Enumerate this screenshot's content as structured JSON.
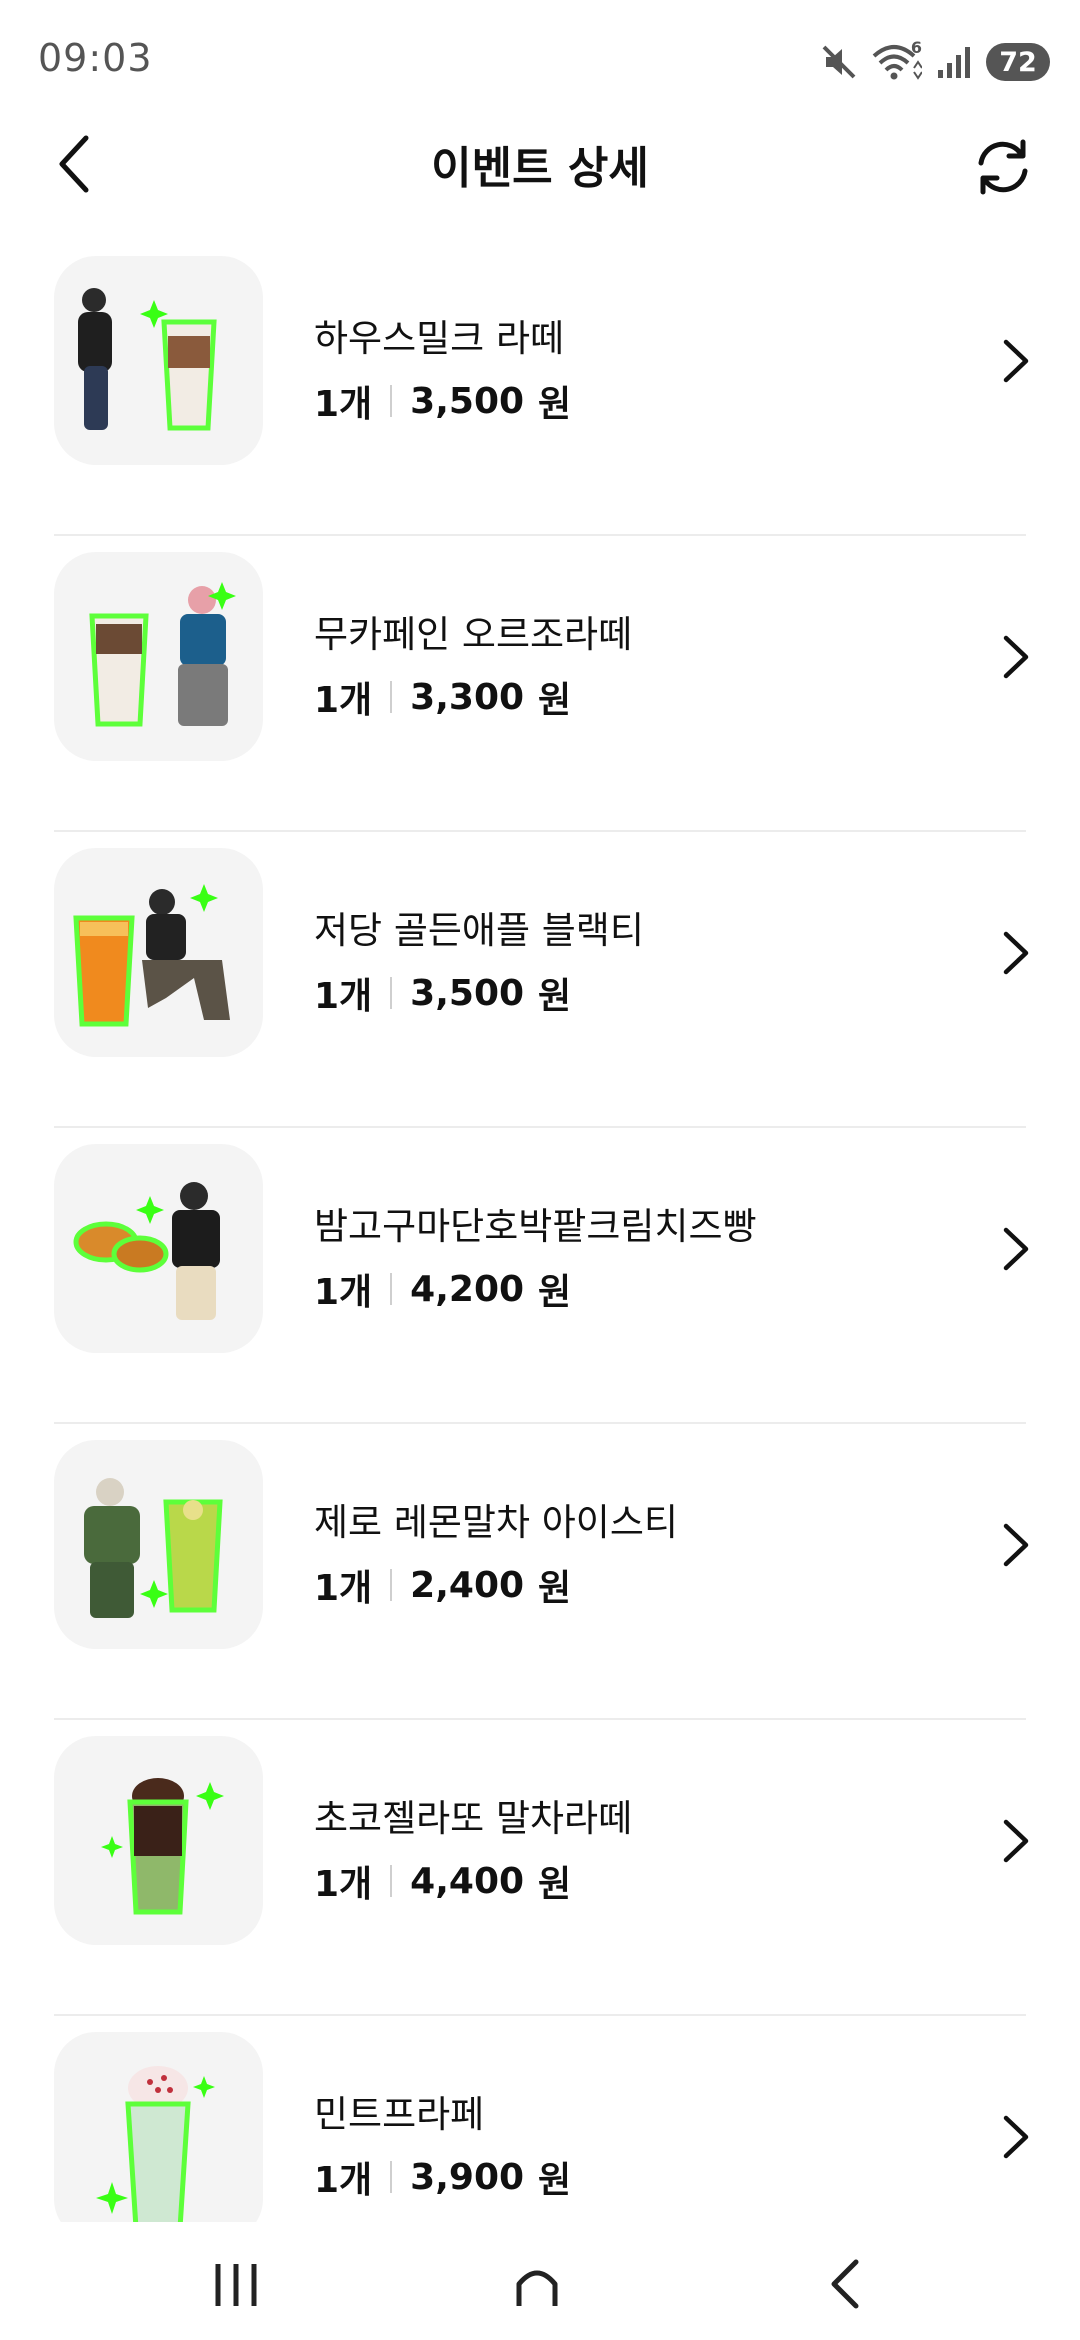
{
  "status_bar": {
    "time": "09:03",
    "battery": "72",
    "wifi_badge": "6",
    "icons": [
      "mute-icon",
      "wifi-icon",
      "signal-icon",
      "battery-icon"
    ]
  },
  "header": {
    "title": "이벤트 상세",
    "back_icon": "chevron-left-icon",
    "refresh_icon": "refresh-icon"
  },
  "items": [
    {
      "name": "하우스밀크 라떼",
      "qty": "1개",
      "price": "3,500",
      "unit": "원"
    },
    {
      "name": "무카페인 오르조라떼",
      "qty": "1개",
      "price": "3,300",
      "unit": "원"
    },
    {
      "name": "저당 골든애플 블랙티",
      "qty": "1개",
      "price": "3,500",
      "unit": "원"
    },
    {
      "name": "밤고구마단호박팥크림치즈빵",
      "qty": "1개",
      "price": "4,200",
      "unit": "원"
    },
    {
      "name": "제로 레몬말차 아이스티",
      "qty": "1개",
      "price": "2,400",
      "unit": "원"
    },
    {
      "name": "초코젤라또 말차라떼",
      "qty": "1개",
      "price": "4,400",
      "unit": "원"
    },
    {
      "name": "민트프라페",
      "qty": "1개",
      "price": "3,900",
      "unit": "원"
    }
  ],
  "nav_bar": {
    "icons": [
      "recent-apps-icon",
      "home-icon",
      "back-icon"
    ]
  },
  "colors": {
    "glow": "#39ff14",
    "thumb_bg": "#f4f4f4",
    "divider": "#ececec"
  }
}
